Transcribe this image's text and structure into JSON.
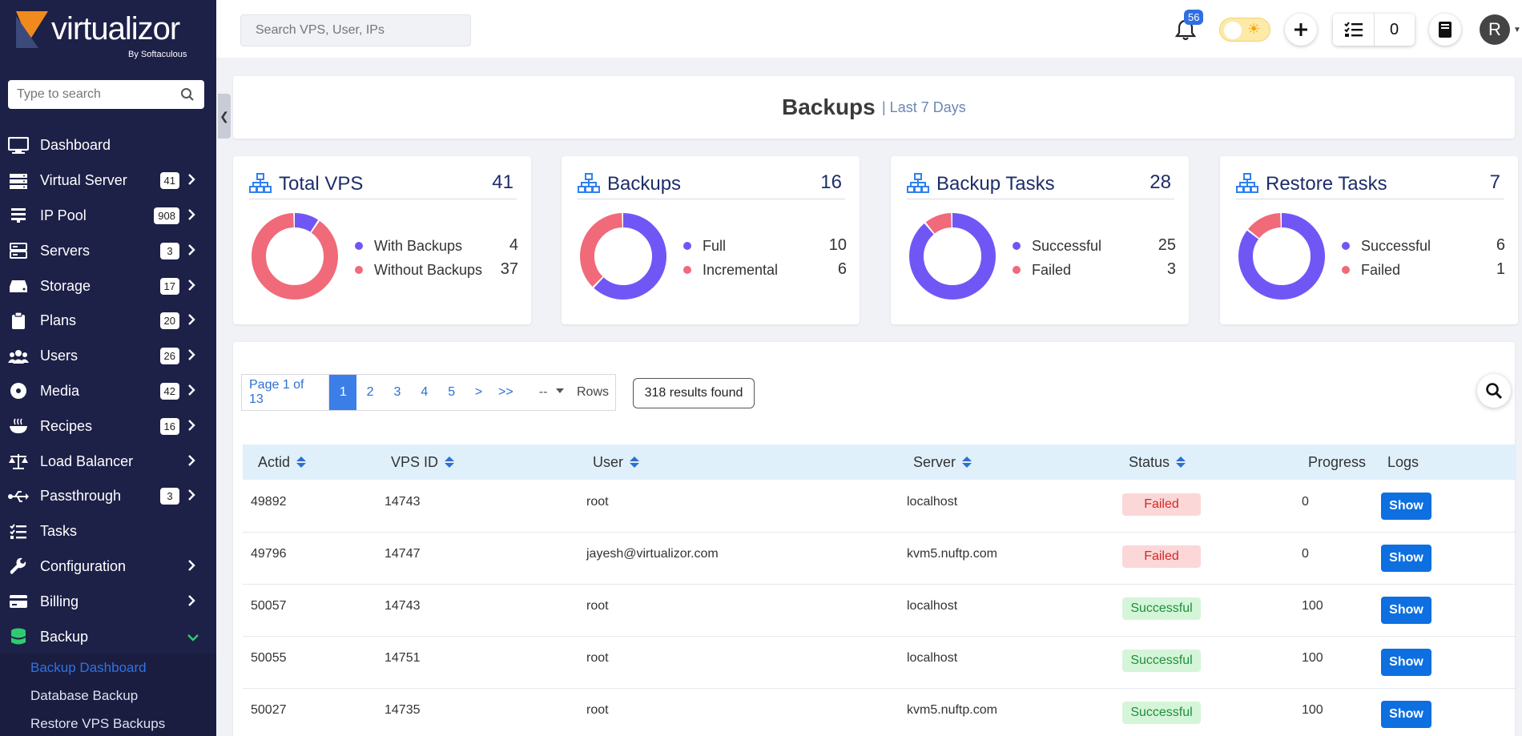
{
  "brand": {
    "name": "virtualizor",
    "by": "By Softaculous"
  },
  "sidebar": {
    "search_placeholder": "Type to search",
    "items": [
      {
        "label": "Dashboard",
        "badge": "",
        "icon": "monitor-icon",
        "chevron": false
      },
      {
        "label": "Virtual Server",
        "badge": "41",
        "icon": "server-stack-icon",
        "chevron": true
      },
      {
        "label": "IP Pool",
        "badge": "908",
        "icon": "ip-pool-icon",
        "chevron": true
      },
      {
        "label": "Servers",
        "badge": "3",
        "icon": "server-icon",
        "chevron": true
      },
      {
        "label": "Storage",
        "badge": "17",
        "icon": "hdd-icon",
        "chevron": true
      },
      {
        "label": "Plans",
        "badge": "20",
        "icon": "clipboard-icon",
        "chevron": true
      },
      {
        "label": "Users",
        "badge": "26",
        "icon": "users-icon",
        "chevron": true
      },
      {
        "label": "Media",
        "badge": "42",
        "icon": "disc-icon",
        "chevron": true
      },
      {
        "label": "Recipes",
        "badge": "16",
        "icon": "bowl-icon",
        "chevron": true
      },
      {
        "label": "Load Balancer",
        "badge": "",
        "icon": "balance-scale-icon",
        "chevron": true
      },
      {
        "label": "Passthrough",
        "badge": "3",
        "icon": "usb-icon",
        "chevron": true
      },
      {
        "label": "Tasks",
        "badge": "",
        "icon": "tasks-list-icon",
        "chevron": false
      },
      {
        "label": "Configuration",
        "badge": "",
        "icon": "wrench-icon",
        "chevron": true
      },
      {
        "label": "Billing",
        "badge": "",
        "icon": "credit-card-icon",
        "chevron": true
      },
      {
        "label": "Backup",
        "badge": "",
        "icon": "database-icon",
        "chevron": true
      }
    ],
    "backup_submenu": [
      "Backup Dashboard",
      "Database Backup",
      "Restore VPS Backups"
    ]
  },
  "topbar": {
    "search_placeholder": "Search VPS, User, IPs",
    "notifications": "56",
    "tasks_count": "0",
    "avatar_letter": "R"
  },
  "page": {
    "title": "Backups",
    "subtitle": "| Last 7 Days"
  },
  "colors": {
    "primary": "#7057f5",
    "secondary": "#f06a7a",
    "sidebar": "#1d2047",
    "accent": "#2f74e0"
  },
  "stats": [
    {
      "title": "Total VPS",
      "value": "41",
      "legend": [
        {
          "label": "With Backups",
          "value": 4
        },
        {
          "label": "Without Backups",
          "value": 37
        }
      ]
    },
    {
      "title": "Backups",
      "value": "16",
      "legend": [
        {
          "label": "Full",
          "value": 10
        },
        {
          "label": "Incremental",
          "value": 6
        }
      ]
    },
    {
      "title": "Backup Tasks",
      "value": "28",
      "legend": [
        {
          "label": "Successful",
          "value": 25
        },
        {
          "label": "Failed",
          "value": 3
        }
      ]
    },
    {
      "title": "Restore Tasks",
      "value": "7",
      "legend": [
        {
          "label": "Successful",
          "value": 6
        },
        {
          "label": "Failed",
          "value": 1
        }
      ]
    }
  ],
  "pagination": {
    "info": "Page 1 of 13",
    "pages": [
      "1",
      "2",
      "3",
      "4",
      "5"
    ],
    "next": ">",
    "last": ">>",
    "rows_value": "--",
    "rows_label": "Rows",
    "results": "318 results found"
  },
  "table": {
    "headers": {
      "actid": "Actid",
      "vpsid": "VPS ID",
      "user": "User",
      "server": "Server",
      "status": "Status",
      "progress": "Progress",
      "logs": "Logs"
    },
    "show_label": "Show",
    "rows": [
      {
        "actid": "49892",
        "vpsid": "14743",
        "user": "root",
        "server": "localhost",
        "status": "Failed",
        "progress": "0"
      },
      {
        "actid": "49796",
        "vpsid": "14747",
        "user": "jayesh@virtualizor.com",
        "server": "kvm5.nuftp.com",
        "status": "Failed",
        "progress": "0"
      },
      {
        "actid": "50057",
        "vpsid": "14743",
        "user": "root",
        "server": "localhost",
        "status": "Successful",
        "progress": "100"
      },
      {
        "actid": "50055",
        "vpsid": "14751",
        "user": "root",
        "server": "localhost",
        "status": "Successful",
        "progress": "100"
      },
      {
        "actid": "50027",
        "vpsid": "14735",
        "user": "root",
        "server": "kvm5.nuftp.com",
        "status": "Successful",
        "progress": "100"
      }
    ]
  }
}
